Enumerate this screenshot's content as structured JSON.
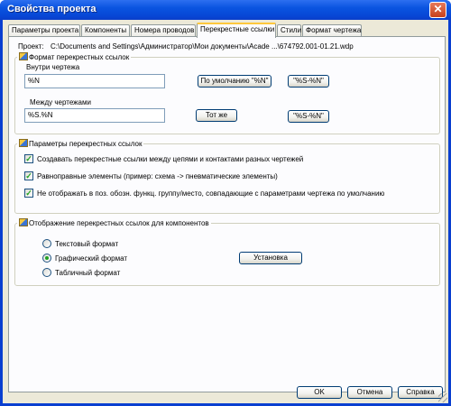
{
  "window": {
    "title": "Свойства проекта",
    "close": "✕"
  },
  "tabs": [
    "Параметры проекта",
    "Компоненты",
    "Номера проводов",
    "Перекрестные ссылки",
    "Стили",
    "Формат чертежа"
  ],
  "active_tab_index": 3,
  "project": {
    "label": "Проект:",
    "path": "C:\\Documents and Settings\\Администратор\\Мои документы\\Acade ...\\674792.001-01.21.wdp"
  },
  "format_group": {
    "title": "Формат перекрестных ссылок",
    "within_label": "Внутри чертежа",
    "within_value": "%N",
    "within_default_button": "По умолчанию \"%N\"",
    "within_alt_button": "\"%S-%N\"",
    "between_label": "Между чертежами",
    "between_value": "%S.%N",
    "between_same_button": "Тот же",
    "between_alt_button": "\"%S-%N\""
  },
  "options_group": {
    "title": "Параметры перекрестных ссылок",
    "items": [
      {
        "label": "Создавать перекрестные ссылки между цепями и контактами разных чертежей",
        "checked": true
      },
      {
        "label": "Равноправные элементы (пример: схема -> пневматические элементы)",
        "checked": true
      },
      {
        "label": "Не отображать в поз. обозн. функц. группу/место, совпадающие с параметрами чертежа по умолчанию",
        "checked": true
      }
    ]
  },
  "display_group": {
    "title": "Отображение перекрестных ссылок для компонентов",
    "options": [
      {
        "label": "Текстовый формат",
        "checked": false
      },
      {
        "label": "Графический формат",
        "checked": true
      },
      {
        "label": "Табличный формат",
        "checked": false
      }
    ],
    "setup_button": "Установка"
  },
  "footer": {
    "ok": "OK",
    "cancel": "Отмена",
    "help": "Справка"
  },
  "colors": {
    "titlebar": "#0a54e0",
    "face": "#ece9d8",
    "active_tab_accent": "#ffc83c",
    "check_mark": "#21a121"
  }
}
